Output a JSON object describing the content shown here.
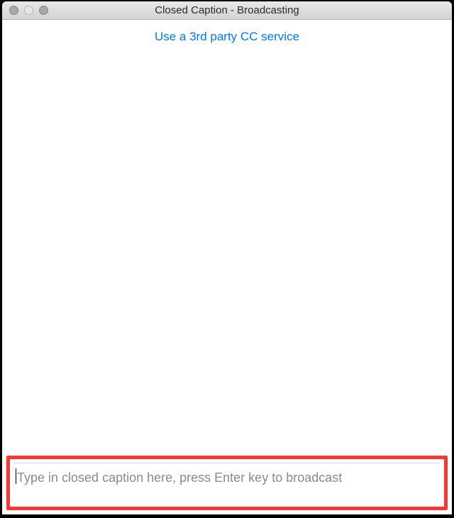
{
  "window": {
    "title": "Closed Caption - Broadcasting"
  },
  "header": {
    "link_text": "Use a 3rd party CC service"
  },
  "input": {
    "placeholder": "Type in closed caption here, press Enter key to broadcast",
    "value": ""
  }
}
